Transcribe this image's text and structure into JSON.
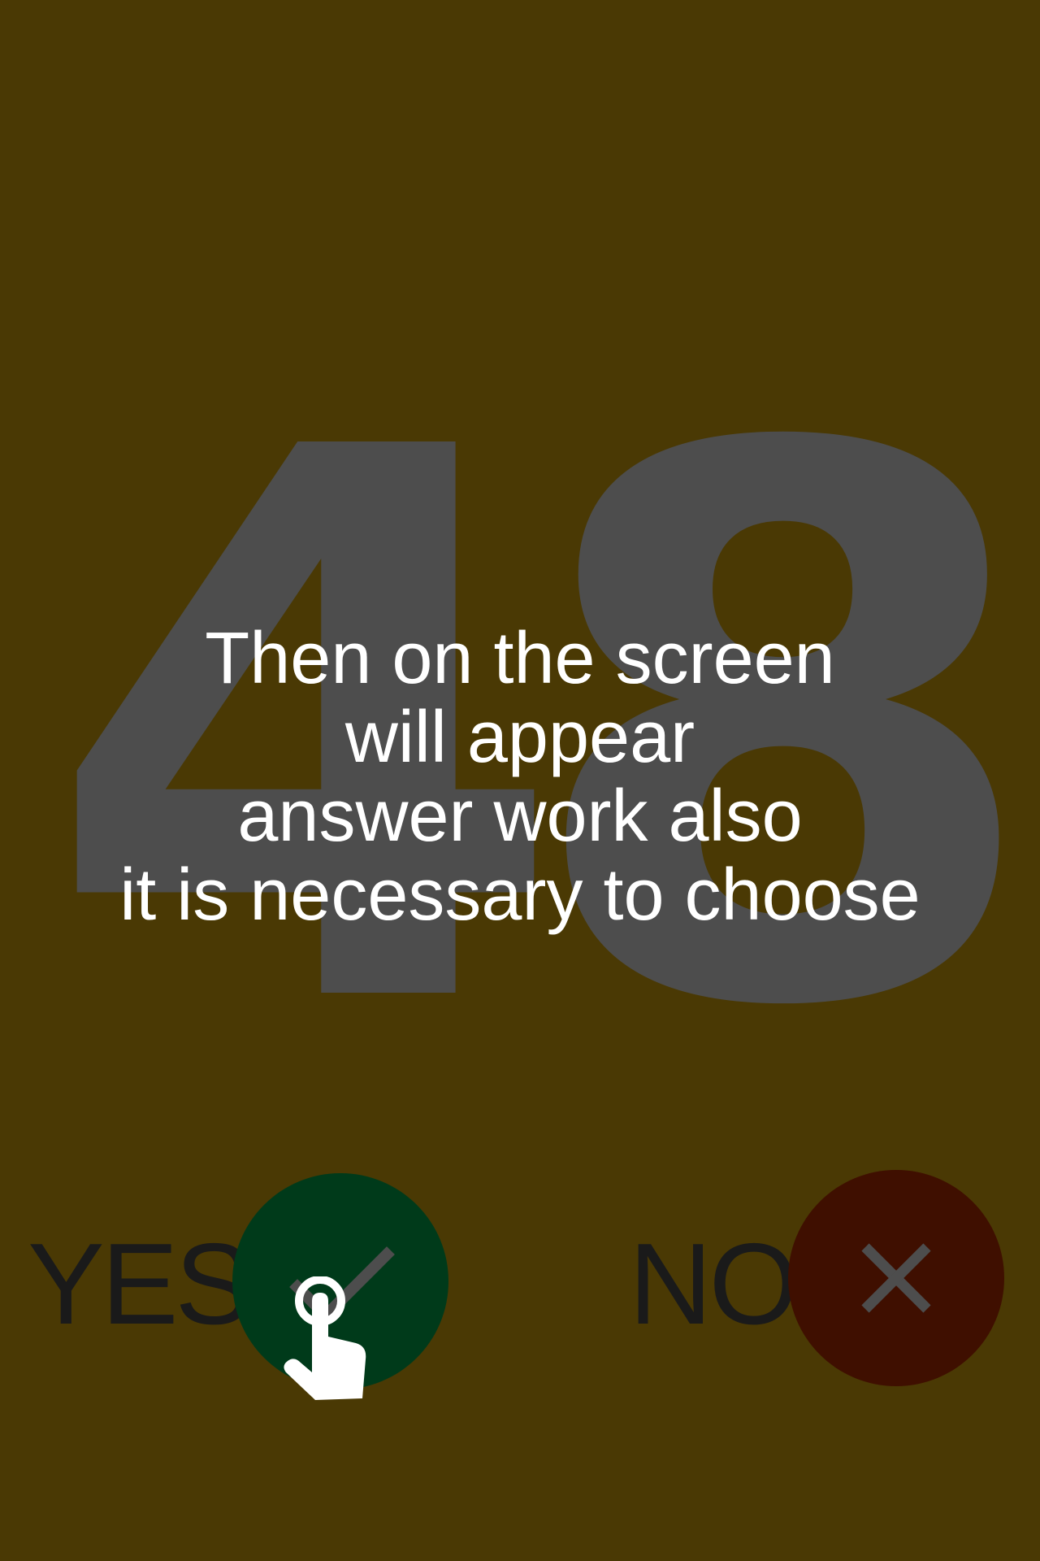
{
  "game": {
    "big_number": "48",
    "tutorial_lines": [
      "Then on the screen",
      "will appear",
      "answer work also",
      "it is necessary to choose"
    ],
    "yes_label": "YES",
    "no_label": "NO"
  },
  "icons": {
    "yes_icon": "check-icon",
    "no_icon": "close-icon",
    "hint_icon": "tap-hand-icon"
  },
  "colors": {
    "background": "#4a3904",
    "number": "#4d4d4d",
    "text": "#ffffff",
    "yes_button": "#003a1a",
    "no_button": "#3f0f00",
    "icon_stroke": "#4d4d4d"
  }
}
